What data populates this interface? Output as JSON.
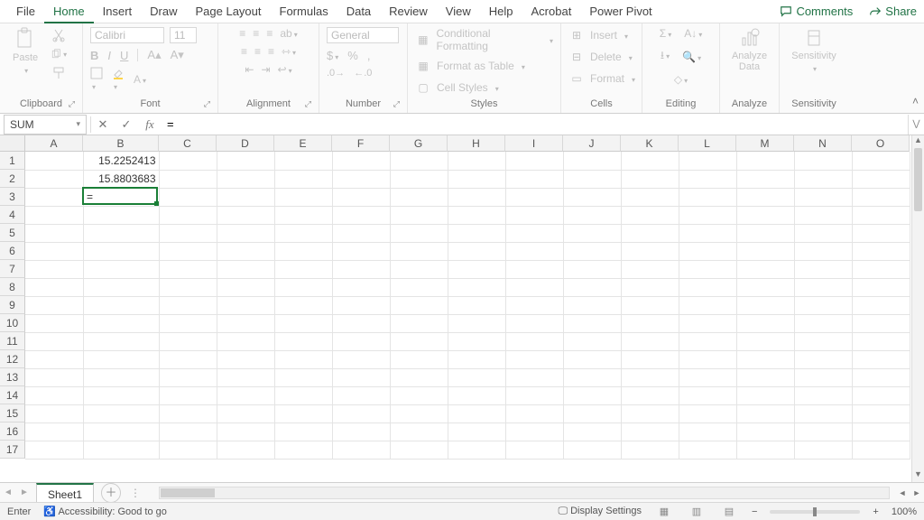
{
  "tabs": {
    "file": "File",
    "home": "Home",
    "insert": "Insert",
    "draw": "Draw",
    "page_layout": "Page Layout",
    "formulas": "Formulas",
    "data": "Data",
    "review": "Review",
    "view": "View",
    "help": "Help",
    "acrobat": "Acrobat",
    "power_pivot": "Power Pivot",
    "comments": "Comments",
    "share": "Share"
  },
  "ribbon": {
    "clipboard": {
      "label": "Clipboard",
      "paste": "Paste"
    },
    "font": {
      "label": "Font",
      "name": "Calibri",
      "size": "11",
      "bold": "B",
      "italic": "I",
      "underline": "U"
    },
    "alignment": {
      "label": "Alignment"
    },
    "number": {
      "label": "Number",
      "format": "General"
    },
    "styles": {
      "label": "Styles",
      "conditional": "Conditional Formatting",
      "table": "Format as Table",
      "cell": "Cell Styles"
    },
    "cells": {
      "label": "Cells",
      "insert": "Insert",
      "delete": "Delete",
      "format": "Format"
    },
    "editing": {
      "label": "Editing"
    },
    "analyze": {
      "label": "Analyze",
      "analyze_data": "Analyze\nData"
    },
    "sensitivity": {
      "label": "Sensitivity",
      "btn": "Sensitivity"
    }
  },
  "formula_bar": {
    "name_box": "SUM",
    "formula": "="
  },
  "grid": {
    "columns": [
      "A",
      "B",
      "C",
      "D",
      "E",
      "F",
      "G",
      "H",
      "I",
      "J",
      "K",
      "L",
      "M",
      "N",
      "O"
    ],
    "rows": [
      "1",
      "2",
      "3",
      "4",
      "5",
      "6",
      "7",
      "8",
      "9",
      "10",
      "11",
      "12",
      "13",
      "14",
      "15",
      "16",
      "17"
    ],
    "b1": "15.2252413",
    "b2": "15.8803683",
    "b3_editing": "="
  },
  "sheet_tabs": {
    "sheet1": "Sheet1"
  },
  "status": {
    "mode": "Enter",
    "accessibility": "Accessibility: Good to go",
    "display_settings": "Display Settings",
    "zoom": "100%"
  }
}
